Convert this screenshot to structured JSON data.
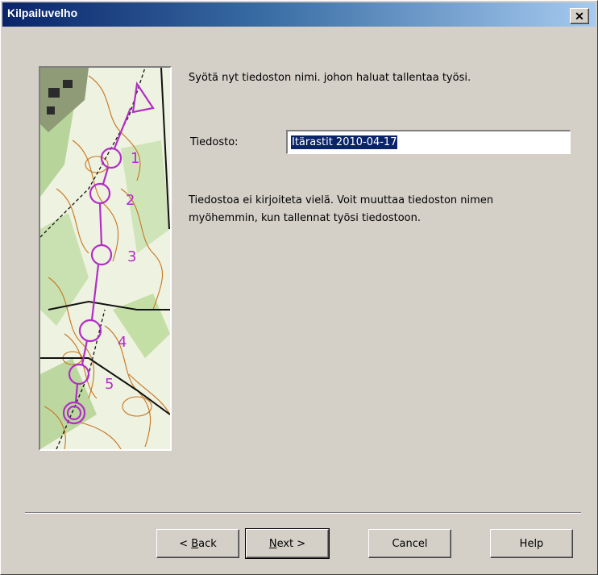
{
  "window": {
    "title": "Kilpailuvelho",
    "close_glyph": "✕"
  },
  "intro_text": "Syötä nyt tiedoston nimi. johon haluat tallentaa työsi.",
  "file": {
    "label": "Tiedosto:",
    "value": "Itärastit 2010-04-17"
  },
  "note_lines": [
    "Tiedostoa ei kirjoiteta vielä. Voit muuttaa tiedoston nimen",
    "myöhemmin, kun tallennat työsi tiedostoon."
  ],
  "buttons": {
    "back": {
      "accel": "B",
      "rest": "ack",
      "prefix": "< "
    },
    "next": {
      "accel": "N",
      "rest": "ext >"
    },
    "cancel": "Cancel",
    "help": "Help"
  },
  "map": {
    "control_numbers": [
      "1",
      "2",
      "3",
      "4",
      "5"
    ]
  }
}
